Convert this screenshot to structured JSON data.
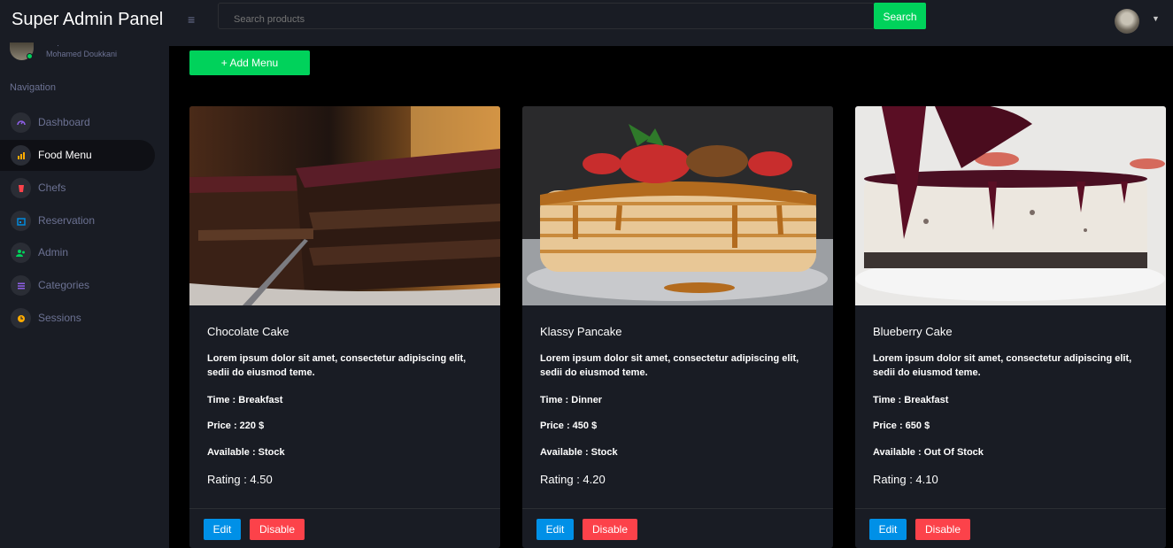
{
  "header": {
    "brand": "Super Admin Panel",
    "search_placeholder": "Search products",
    "search_button": "Search"
  },
  "sidebar": {
    "user_name": "Mohamed Doukkani",
    "nav_heading": "Navigation",
    "items": [
      {
        "label": "Dashboard",
        "icon": "speedometer-icon",
        "color": "#8f5fe8",
        "active": false
      },
      {
        "label": "Food Menu",
        "icon": "bar-chart-icon",
        "color": "#ffab00",
        "active": true
      },
      {
        "label": "Chefs",
        "icon": "chef-hat-icon",
        "color": "#fc424a",
        "active": false
      },
      {
        "label": "Reservation",
        "icon": "calendar-icon",
        "color": "#0090e7",
        "active": false
      },
      {
        "label": "Admin",
        "icon": "users-icon",
        "color": "#00d25b",
        "active": false
      },
      {
        "label": "Categories",
        "icon": "list-icon",
        "color": "#8f5fe8",
        "active": false
      },
      {
        "label": "Sessions",
        "icon": "clock-icon",
        "color": "#ffab00",
        "active": false
      }
    ]
  },
  "main": {
    "add_button": "+ Add Menu",
    "cards": [
      {
        "title": "Chocolate Cake",
        "description": "Lorem ipsum dolor sit amet, consectetur adipiscing elit, sedii do eiusmod teme.",
        "time": "Time : Breakfast",
        "price": "Price : 220 $",
        "available": "Available : Stock",
        "rating": "Rating : 4.50",
        "edit": "Edit",
        "disable": "Disable"
      },
      {
        "title": "Klassy Pancake",
        "description": "Lorem ipsum dolor sit amet, consectetur adipiscing elit, sedii do eiusmod teme.",
        "time": "Time : Dinner",
        "price": "Price : 450 $",
        "available": "Available : Stock",
        "rating": "Rating : 4.20",
        "edit": "Edit",
        "disable": "Disable"
      },
      {
        "title": "Blueberry Cake",
        "description": "Lorem ipsum dolor sit amet, consectetur adipiscing elit, sedii do eiusmod teme.",
        "time": "Time : Breakfast",
        "price": "Price : 650 $",
        "available": "Available : Out Of Stock",
        "rating": "Rating : 4.10",
        "edit": "Edit",
        "disable": "Disable"
      }
    ]
  },
  "colors": {
    "accent_green": "#00d25b",
    "edit_blue": "#0090e7",
    "disable_red": "#fc424a",
    "panel_bg": "#191c24"
  }
}
